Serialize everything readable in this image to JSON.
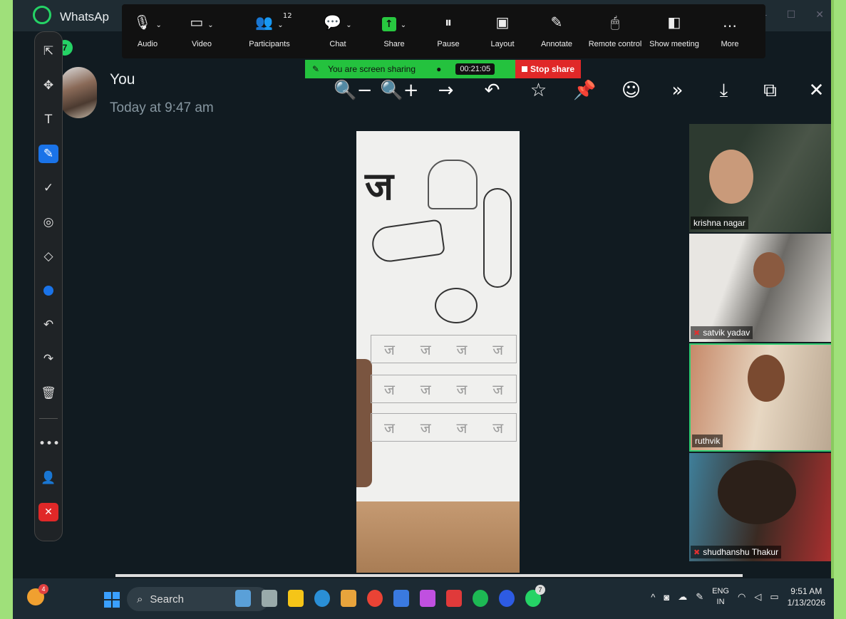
{
  "window": {
    "title": "WhatsAp",
    "unread_badge": "7",
    "controls": [
      "—",
      "☐",
      "✕"
    ]
  },
  "zoom_toolbar": {
    "items": [
      {
        "label": "Audio",
        "icon": "🎙",
        "caret": "⌄"
      },
      {
        "label": "Video",
        "icon": "▭",
        "caret": "⌄"
      },
      {
        "label": "Participants",
        "icon": "👥",
        "count": "12",
        "caret": "⌄"
      },
      {
        "label": "Chat",
        "icon": "💬",
        "caret": "⌄"
      },
      {
        "label": "Share",
        "icon": "↑",
        "caret": "⌄"
      },
      {
        "label": "Pause",
        "icon": "⏸"
      },
      {
        "label": "Layout",
        "icon": "▣"
      },
      {
        "label": "Annotate",
        "icon": "✎"
      },
      {
        "label": "Remote control",
        "icon": "🖱"
      },
      {
        "label": "Show meeting",
        "icon": "◧"
      },
      {
        "label": "More",
        "icon": "…"
      }
    ]
  },
  "share_bar": {
    "status": "You are screen sharing",
    "timer": "00:21:05",
    "stop_label": "Stop share"
  },
  "annotation_tools": [
    "⇱",
    "✥",
    "T",
    "✎",
    "✓",
    "◎",
    "◇",
    "●",
    "↶",
    "↷",
    "🗑",
    "•••",
    "👤",
    "✕"
  ],
  "message": {
    "sender": "You",
    "time": "Today at 9:47 am"
  },
  "viewer_tools": [
    "🔍−",
    "🔍+",
    "→",
    "↶",
    "☆",
    "📌",
    "☺",
    "»",
    "⤓",
    "⧉",
    "✕"
  ],
  "worksheet": {
    "letter": "ज",
    "trace_char": "ज"
  },
  "participants": [
    {
      "name": "krishna nagar",
      "muted": false,
      "speaking": false
    },
    {
      "name": "satvik yadav",
      "muted": true,
      "speaking": false
    },
    {
      "name": "ruthvik",
      "muted": false,
      "speaking": true
    },
    {
      "name": "shudhanshu Thakur",
      "muted": true,
      "speaking": false
    }
  ],
  "taskbar": {
    "weather_badge": "4",
    "search_placeholder": "Search",
    "whatsapp_badge": "7",
    "language": {
      "line1": "ENG",
      "line2": "IN"
    },
    "time": "9:51 AM",
    "date": "1/13/2026",
    "app_colors": [
      "#5aa0d8",
      "#9aa",
      "#f5c518",
      "#2a8fd6",
      "#e8a43c",
      "#ea4335",
      "#3a7ae0",
      "#c050e0",
      "#e03a3a",
      "#1db954",
      "#2d5be3",
      "#25d366"
    ]
  }
}
